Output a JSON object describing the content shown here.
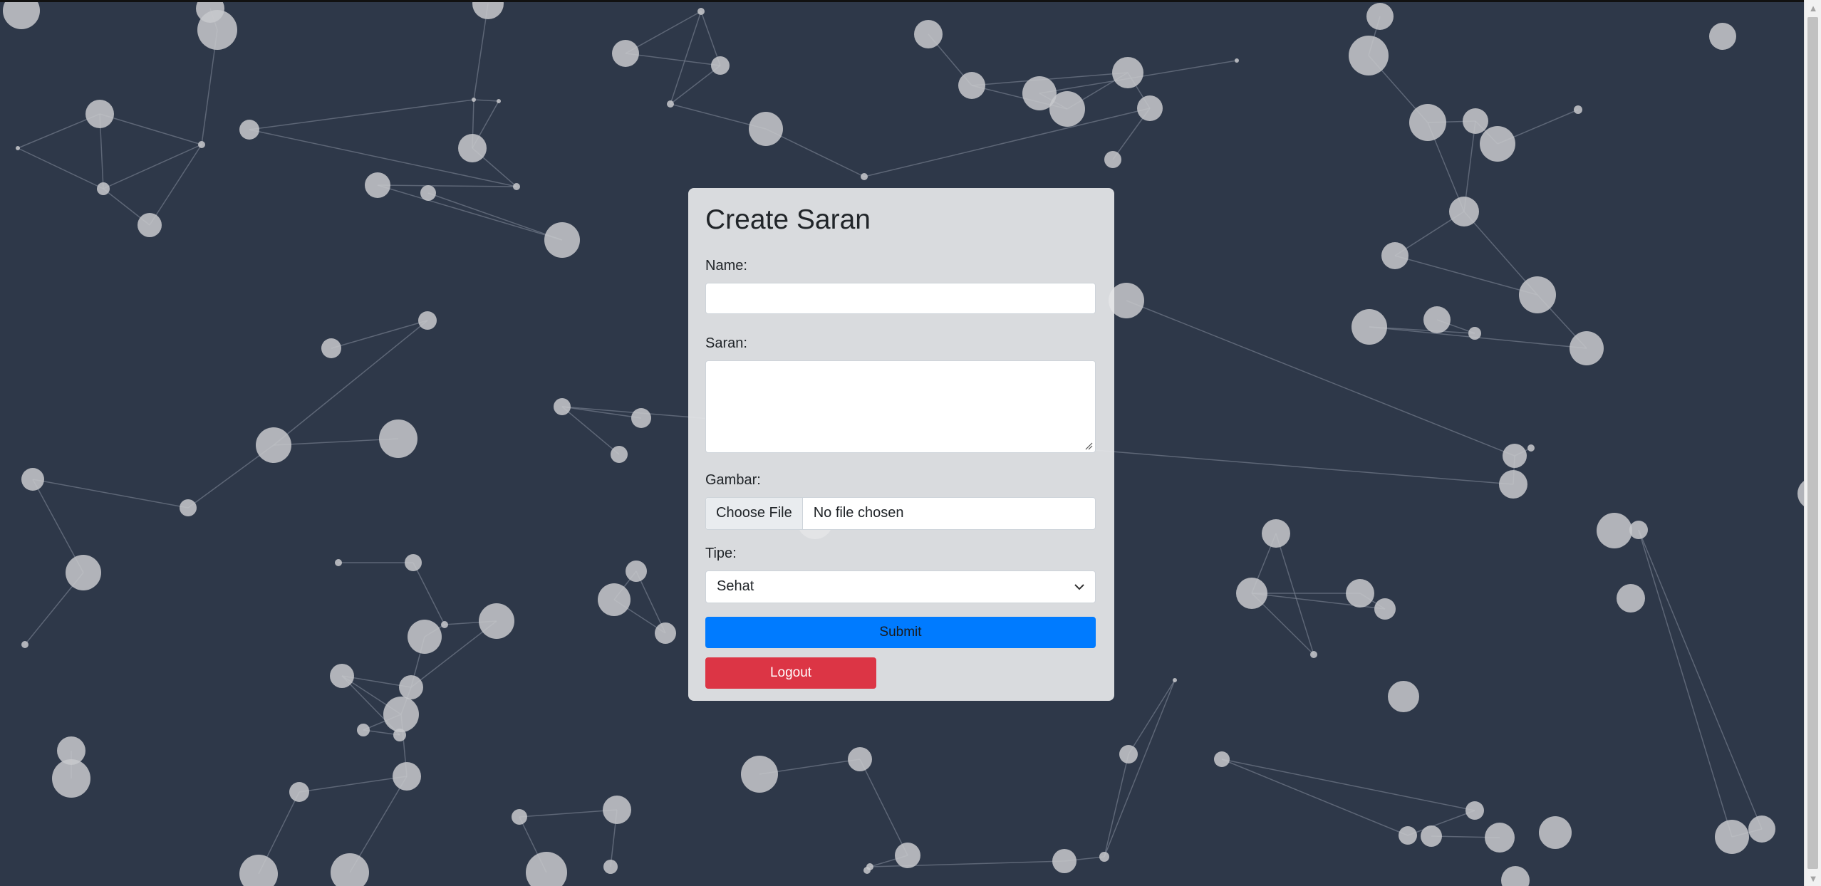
{
  "form": {
    "title": "Create Saran",
    "name_label": "Name:",
    "name_value": "",
    "saran_label": "Saran:",
    "saran_value": "",
    "gambar_label": "Gambar:",
    "file_button_label": "Choose File",
    "file_status": "No file chosen",
    "tipe_label": "Tipe:",
    "tipe_selected": "Sehat",
    "submit_label": "Submit",
    "logout_label": "Logout"
  },
  "colors": {
    "background": "#2e3849",
    "card": "#e6e7ea",
    "submit": "#007bff",
    "logout": "#dc3545",
    "particle": "#c8c9cc"
  },
  "icons": {
    "select_caret": "chevron-down-icon",
    "scroll_up": "triangle-up-icon",
    "scroll_down": "triangle-down-icon"
  }
}
